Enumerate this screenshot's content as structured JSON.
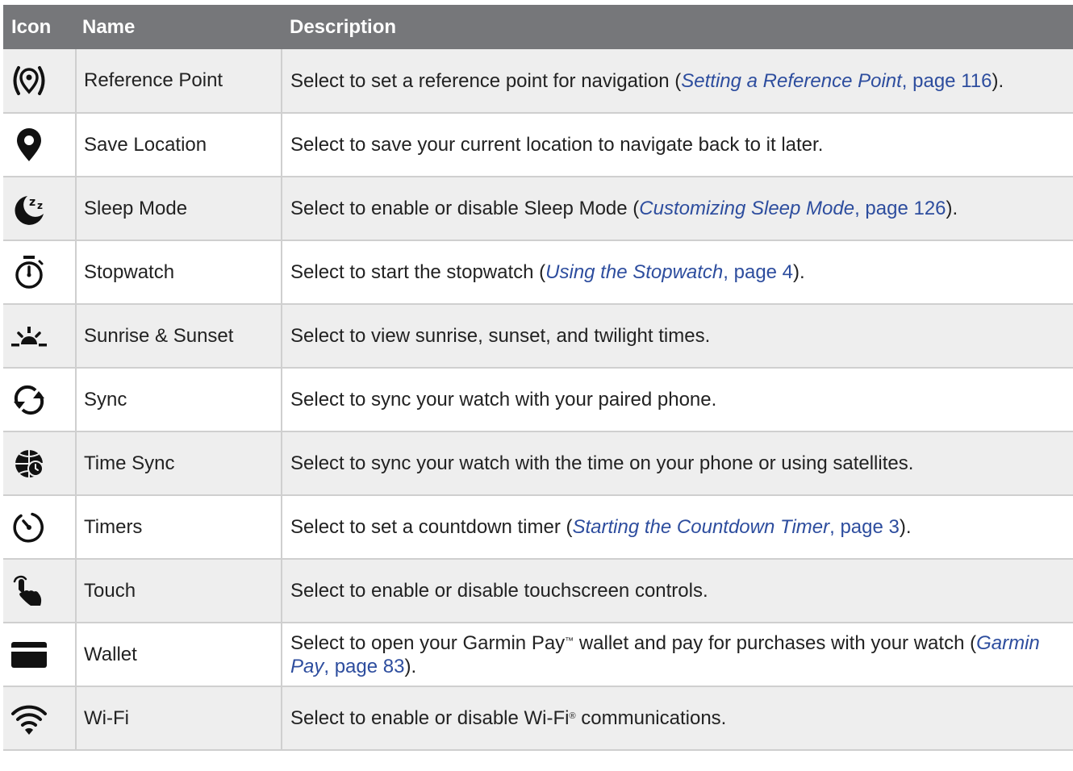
{
  "headers": {
    "icon": "Icon",
    "name": "Name",
    "description": "Description"
  },
  "rows": [
    {
      "icon": "reference-point-icon",
      "name": "Reference Point",
      "desc_pre": "Select to set a reference point for navigation (",
      "link_title": "Setting a Reference Point",
      "link_page": ", page 116",
      "desc_post": ")."
    },
    {
      "icon": "location-pin-icon",
      "name": "Save Location",
      "desc": "Select to save your current location to navigate back to it later."
    },
    {
      "icon": "sleep-moon-icon",
      "name": "Sleep Mode",
      "desc_pre": "Select to enable or disable Sleep Mode (",
      "link_title": "Customizing Sleep Mode",
      "link_page": ", page 126",
      "desc_post": ")."
    },
    {
      "icon": "stopwatch-icon",
      "name": "Stopwatch",
      "desc_pre": "Select to start the stopwatch (",
      "link_title": "Using the Stopwatch",
      "link_page": ", page 4",
      "desc_post": ")."
    },
    {
      "icon": "sunrise-icon",
      "name": "Sunrise & Sunset",
      "desc": "Select to view sunrise, sunset, and twilight times."
    },
    {
      "icon": "sync-arrows-icon",
      "name": "Sync",
      "desc": "Select to sync your watch with your paired phone."
    },
    {
      "icon": "globe-clock-icon",
      "name": "Time Sync",
      "desc": "Select to sync your watch with the time on your phone or using satellites."
    },
    {
      "icon": "timer-icon",
      "name": "Timers",
      "desc_pre": "Select to set a countdown timer (",
      "link_title": "Starting the Countdown Timer",
      "link_page": ", page 3",
      "desc_post": ")."
    },
    {
      "icon": "touch-hand-icon",
      "name": "Touch",
      "desc": "Select to enable or disable touchscreen controls."
    },
    {
      "icon": "wallet-card-icon",
      "name": "Wallet",
      "desc_pre": "Select to open your Garmin Pay",
      "desc_tm": "™",
      "desc_mid": " wallet and pay for purchases with your watch (",
      "link_title": "Garmin Pay",
      "link_page": ", page 83",
      "desc_post": ")."
    },
    {
      "icon": "wifi-icon",
      "name": "Wi-Fi",
      "desc_pre": "Select to enable or disable Wi-Fi",
      "desc_reg": "®",
      "desc_post": " communications."
    }
  ]
}
